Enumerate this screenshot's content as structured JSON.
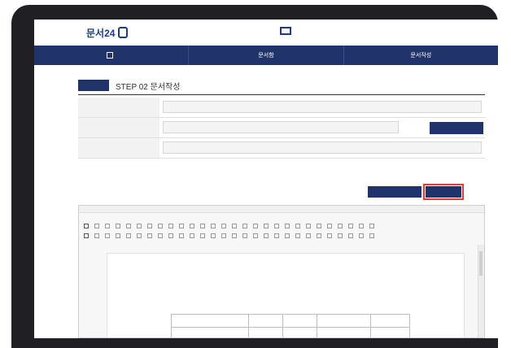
{
  "logo": {
    "sub": "",
    "main": "문서24"
  },
  "topbar": {
    "small_1": "",
    "small_2": "",
    "small_3": "",
    "small_4": "",
    "small_5": ""
  },
  "nav": {
    "items": [
      {
        "label": ""
      },
      {
        "label": "문서함"
      },
      {
        "label": "문서작성"
      }
    ]
  },
  "step": {
    "badge": "",
    "title": "STEP 02 문서작성"
  },
  "form": {
    "rows": [
      {
        "label": "",
        "value": ""
      },
      {
        "label": "",
        "value": "",
        "button": ""
      },
      {
        "label": "",
        "value": ""
      }
    ]
  },
  "notice": "",
  "actions": {
    "left": "",
    "right": ""
  },
  "editor": {
    "menu": [
      "",
      "",
      "",
      "",
      "",
      "",
      "",
      "",
      ""
    ],
    "body_lines": [
      "",
      ""
    ],
    "bullet": "",
    "table_headers": [
      "",
      "",
      "",
      "",
      ""
    ]
  },
  "colors": {
    "brand_blue": "#20336b",
    "highlight_red": "#e53935"
  }
}
